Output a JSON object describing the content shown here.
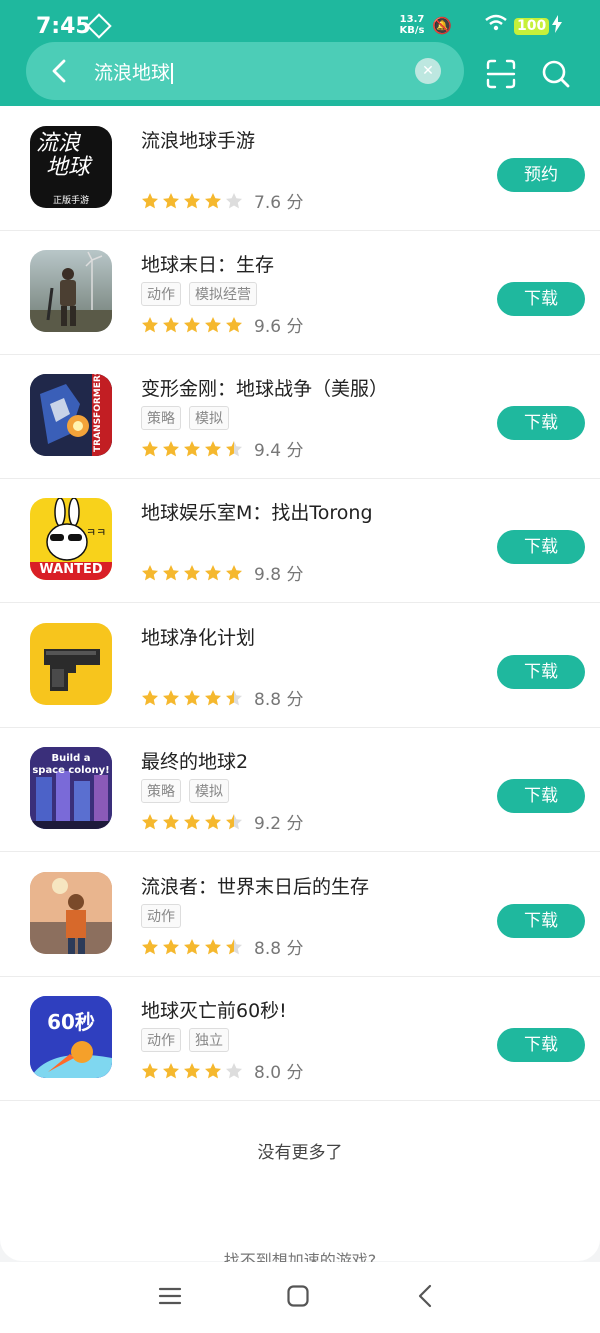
{
  "status": {
    "time": "7:45",
    "speed": "13.7",
    "speed_unit": "KB/s",
    "battery": "100"
  },
  "search": {
    "query": "流浪地球"
  },
  "results": [
    {
      "title": "流浪地球手游",
      "tags": [],
      "rating": 4,
      "score": "7.6 分",
      "button": "预约",
      "icon_text": [
        "流浪",
        "地球"
      ],
      "icon_sub": "正版手游"
    },
    {
      "title": "地球末日：生存",
      "tags": [
        "动作",
        "模拟经营"
      ],
      "rating": 5,
      "score": "9.6 分",
      "button": "下载"
    },
    {
      "title": "变形金刚：地球战争（美服）",
      "tags": [
        "策略",
        "模拟"
      ],
      "rating": 4.5,
      "score": "9.4 分",
      "button": "下载",
      "icon_text": [
        "TRANSFORMERS"
      ]
    },
    {
      "title": "地球娱乐室M：找出Torong",
      "tags": [],
      "rating": 5,
      "score": "9.8 分",
      "button": "下载",
      "icon_text": [
        "WANTED",
        "ㅋㅋ"
      ]
    },
    {
      "title": "地球净化计划",
      "tags": [],
      "rating": 4.5,
      "score": "8.8 分",
      "button": "下载"
    },
    {
      "title": "最终的地球2",
      "tags": [
        "策略",
        "模拟"
      ],
      "rating": 4.5,
      "score": "9.2 分",
      "button": "下载",
      "icon_text": [
        "Build a",
        "space colony!"
      ]
    },
    {
      "title": "流浪者：世界末日后的生存",
      "tags": [
        "动作"
      ],
      "rating": 4.5,
      "score": "8.8 分",
      "button": "下载"
    },
    {
      "title": "地球灭亡前60秒!",
      "tags": [
        "动作",
        "独立"
      ],
      "rating": 4,
      "score": "8.0 分",
      "button": "下载",
      "icon_text": [
        "60秒"
      ]
    }
  ],
  "footer": {
    "no_more": "没有更多了",
    "not_found": "找不到想加速的游戏?"
  },
  "colors": {
    "accent": "#1fb89e",
    "star": "#f5b82e",
    "star_empty": "#dddddd"
  }
}
